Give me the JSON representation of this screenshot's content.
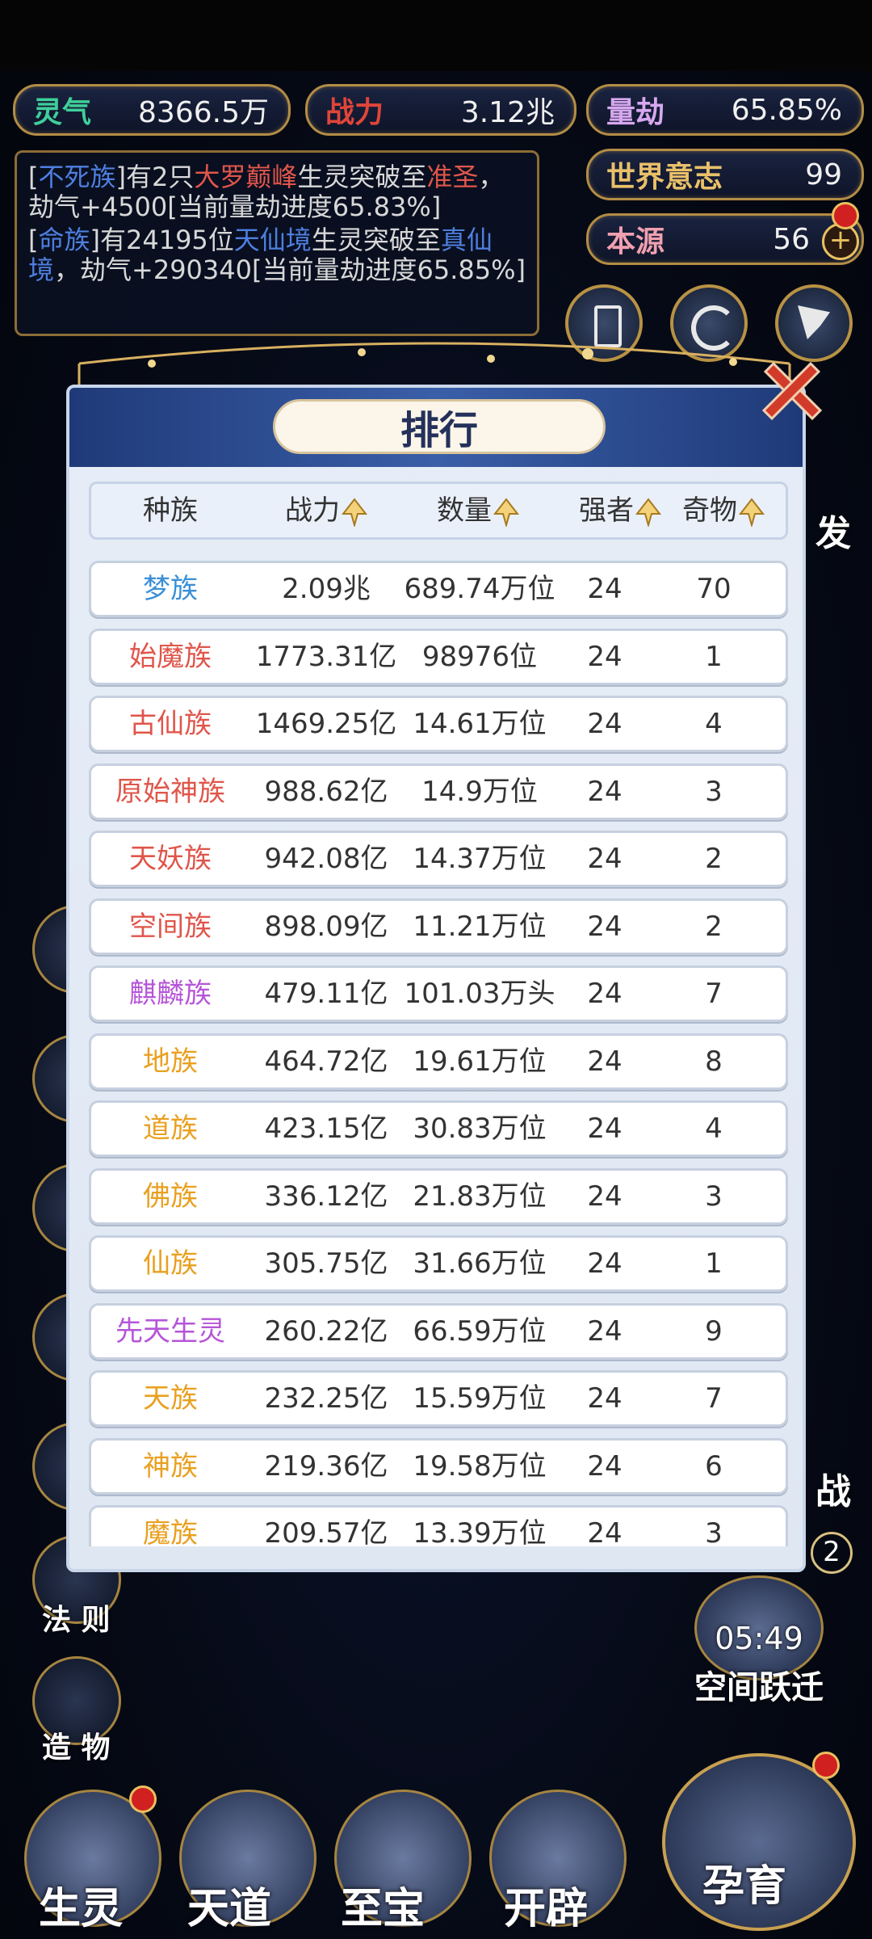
{
  "resources": {
    "lingqi": {
      "label": "灵气",
      "value": "8366.5万"
    },
    "zhanli": {
      "label": "战力",
      "value": "3.12兆"
    },
    "liangjie": {
      "label": "量劫",
      "value": "65.85%"
    },
    "world_will": {
      "label": "世界意志",
      "value": "99"
    },
    "benyuan": {
      "label": "本源",
      "value": "56"
    }
  },
  "messages": [
    {
      "p1": "[",
      "race": "不死族",
      "p2": "]有2只",
      "realm1": "大罗巅峰",
      "p3": "生灵突破至",
      "realm2": "准圣",
      "p4": "，劫气+4500[当前量劫进度65.83%]"
    },
    {
      "p1": "[",
      "race": "命族",
      "p2": "]有24195位",
      "realm1": "天仙境",
      "p3": "生灵突破至",
      "realm2": "真仙境",
      "p4": "，劫气+290340[当前量劫进度65.85%]"
    }
  ],
  "side_labels": {
    "right_fa": "发",
    "right_zhan": "战",
    "badge": "2"
  },
  "left_menu": {
    "fa_ze": "法 则",
    "zao_wu": "造 物"
  },
  "space_jump": {
    "timer": "05:49",
    "label": "空间跃迁"
  },
  "bottom_nav": {
    "sheng_ling": "生灵",
    "tian_dao": "天道",
    "zhi_bao": "至宝",
    "kai_pi": "开辟",
    "yun_yu": "孕育"
  },
  "ranking": {
    "title": "排行",
    "headers": {
      "race": "种族",
      "power": "战力",
      "count": "数量",
      "strong": "强者",
      "items": "奇物"
    },
    "rows": [
      {
        "race": "梦族",
        "color": "#3a8fd8",
        "power": "2.09兆",
        "count": "689.74万位",
        "strong": "24",
        "items": "70"
      },
      {
        "race": "始魔族",
        "color": "#e0554a",
        "power": "1773.31亿",
        "count": "98976位",
        "strong": "24",
        "items": "1"
      },
      {
        "race": "古仙族",
        "color": "#e0554a",
        "power": "1469.25亿",
        "count": "14.61万位",
        "strong": "24",
        "items": "4"
      },
      {
        "race": "原始神族",
        "color": "#e0554a",
        "power": "988.62亿",
        "count": "14.9万位",
        "strong": "24",
        "items": "3"
      },
      {
        "race": "天妖族",
        "color": "#e0554a",
        "power": "942.08亿",
        "count": "14.37万位",
        "strong": "24",
        "items": "2"
      },
      {
        "race": "空间族",
        "color": "#e0554a",
        "power": "898.09亿",
        "count": "11.21万位",
        "strong": "24",
        "items": "2"
      },
      {
        "race": "麒麟族",
        "color": "#b655d8",
        "power": "479.11亿",
        "count": "101.03万头",
        "strong": "24",
        "items": "7"
      },
      {
        "race": "地族",
        "color": "#e9a020",
        "power": "464.72亿",
        "count": "19.61万位",
        "strong": "24",
        "items": "8"
      },
      {
        "race": "道族",
        "color": "#e9a020",
        "power": "423.15亿",
        "count": "30.83万位",
        "strong": "24",
        "items": "4"
      },
      {
        "race": "佛族",
        "color": "#e9a020",
        "power": "336.12亿",
        "count": "21.83万位",
        "strong": "24",
        "items": "3"
      },
      {
        "race": "仙族",
        "color": "#e9a020",
        "power": "305.75亿",
        "count": "31.66万位",
        "strong": "24",
        "items": "1"
      },
      {
        "race": "先天生灵",
        "color": "#b655d8",
        "power": "260.22亿",
        "count": "66.59万位",
        "strong": "24",
        "items": "9"
      },
      {
        "race": "天族",
        "color": "#e9a020",
        "power": "232.25亿",
        "count": "15.59万位",
        "strong": "24",
        "items": "7"
      },
      {
        "race": "神族",
        "color": "#e9a020",
        "power": "219.36亿",
        "count": "19.58万位",
        "strong": "24",
        "items": "6"
      },
      {
        "race": "魔族",
        "color": "#e9a020",
        "power": "209.57亿",
        "count": "13.39万位",
        "strong": "24",
        "items": "3"
      }
    ]
  }
}
